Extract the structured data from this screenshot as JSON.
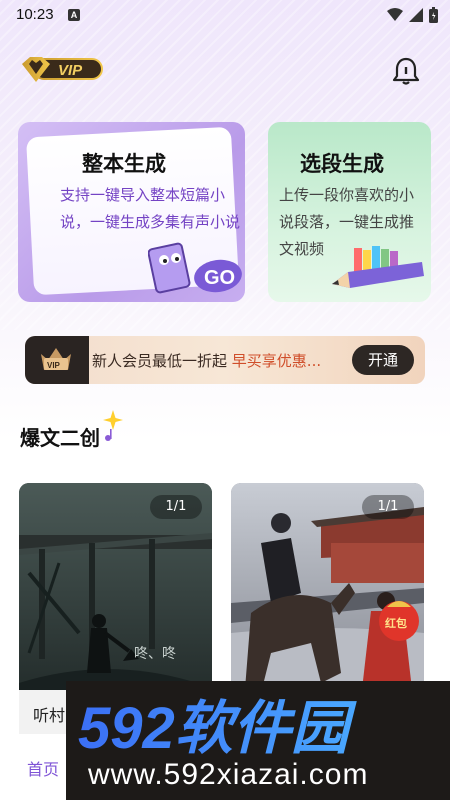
{
  "status_bar": {
    "time": "10:23",
    "notif_letter": "A"
  },
  "header": {
    "vip_label": "VIP"
  },
  "cards": [
    {
      "title": "整本生成",
      "desc": "支持一键导入整本短篇小说，一键生成多集有声小说",
      "sticker": "GO"
    },
    {
      "title": "选段生成",
      "desc": "上传一段你喜欢的小说段落，一键生成推文视频"
    }
  ],
  "promo": {
    "crown_label": "VIP",
    "text": "新人会员最低一折起",
    "highlight": "早买享优惠...",
    "button": "开通"
  },
  "section": {
    "title": "爆文二创"
  },
  "stories": [
    {
      "count": "1/1",
      "overlay_text": "咚、咚",
      "caption": "听村"
    },
    {
      "count": "1/1",
      "bag_text": "红包"
    }
  ],
  "bottom_nav": {
    "home": "首页"
  },
  "watermark": {
    "logo": "592软件园",
    "url": "www.592xiazai.com"
  },
  "colors": {
    "accent": "#7f54d6",
    "promo_highlight": "#d04e2a"
  }
}
